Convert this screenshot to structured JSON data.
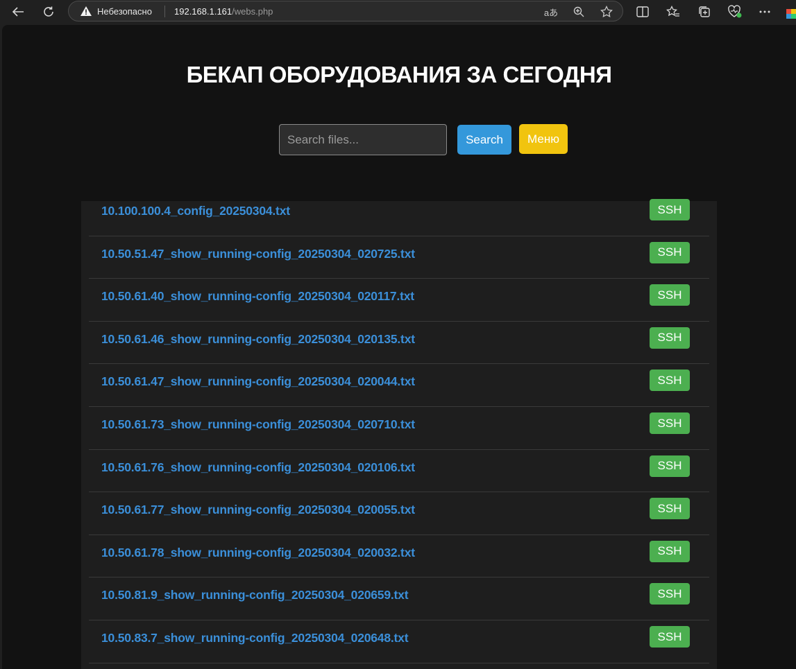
{
  "browser": {
    "security_label": "Небезопасно",
    "url_host": "192.168.1.161",
    "url_path": "/webs.php",
    "read_aloud_label": "aあ"
  },
  "page": {
    "title": "БЕКАП ОБОРУДОВАНИЯ ЗА СЕГОДНЯ",
    "search_placeholder": "Search files...",
    "search_button": "Search",
    "menu_button": "Меню"
  },
  "files": [
    {
      "name": "10.100.100.4_config_20250304.txt",
      "action": "SSH"
    },
    {
      "name": "10.50.51.47_show_running-config_20250304_020725.txt",
      "action": "SSH"
    },
    {
      "name": "10.50.61.40_show_running-config_20250304_020117.txt",
      "action": "SSH"
    },
    {
      "name": "10.50.61.46_show_running-config_20250304_020135.txt",
      "action": "SSH"
    },
    {
      "name": "10.50.61.47_show_running-config_20250304_020044.txt",
      "action": "SSH"
    },
    {
      "name": "10.50.61.73_show_running-config_20250304_020710.txt",
      "action": "SSH"
    },
    {
      "name": "10.50.61.76_show_running-config_20250304_020106.txt",
      "action": "SSH"
    },
    {
      "name": "10.50.61.77_show_running-config_20250304_020055.txt",
      "action": "SSH"
    },
    {
      "name": "10.50.61.78_show_running-config_20250304_020032.txt",
      "action": "SSH"
    },
    {
      "name": "10.50.81.9_show_running-config_20250304_020659.txt",
      "action": "SSH"
    },
    {
      "name": "10.50.83.7_show_running-config_20250304_020648.txt",
      "action": "SSH"
    }
  ],
  "colors": {
    "link": "#3b8fd9",
    "search_button": "#3498db",
    "menu_button": "#f1c40f",
    "ssh_button": "#4caf50"
  },
  "icons": [
    "back-arrow-icon",
    "refresh-icon",
    "warning-icon",
    "read-aloud-icon",
    "zoom-icon",
    "favorite-star-icon",
    "split-screen-icon",
    "favorites-icon",
    "collections-icon",
    "browser-essentials-icon",
    "more-menu-icon",
    "copilot-icon"
  ]
}
